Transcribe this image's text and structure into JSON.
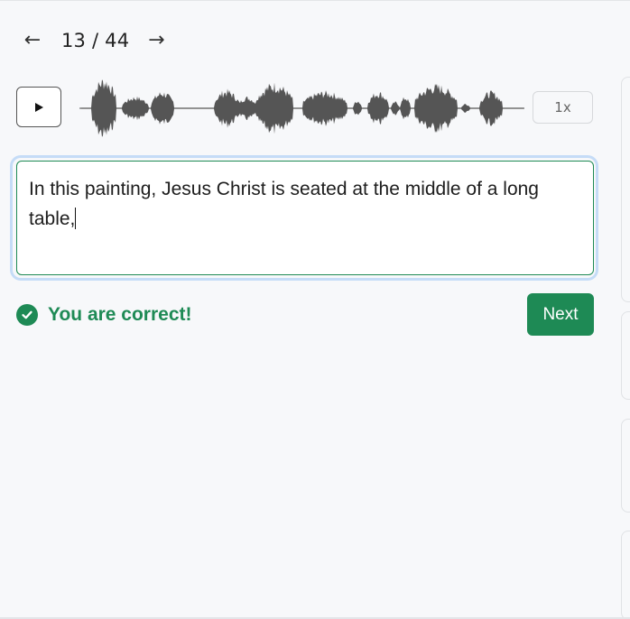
{
  "navigation": {
    "prev_icon": "←",
    "counter": "13 / 44",
    "next_icon": "→"
  },
  "audio": {
    "play_icon": "play-icon",
    "speed_label": "1x"
  },
  "answer": {
    "text": "In this painting, Jesus Christ is seated at the middle of a long table,"
  },
  "feedback": {
    "icon": "check-circle-icon",
    "message": "You are correct!",
    "color": "#1e8a55"
  },
  "actions": {
    "next_label": "Next"
  },
  "colors": {
    "accent": "#1e8a55",
    "focus_ring": "#c5dcf7",
    "waveform": "#555555"
  }
}
